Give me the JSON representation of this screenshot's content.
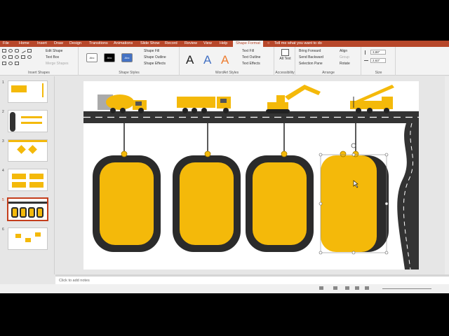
{
  "tabs": [
    "File",
    "Home",
    "Insert",
    "Draw",
    "Design",
    "Transitions",
    "Animations",
    "Slide Show",
    "Record",
    "Review",
    "View",
    "Help",
    "Shape Format"
  ],
  "active_tab": "Shape Format",
  "tell_me": "Tell me what you want to do",
  "ribbon": {
    "insert_shapes": {
      "edit_shape": "Edit Shape",
      "text_box": "Text Box",
      "merge_shapes": "Merge Shapes",
      "label": "Insert Shapes"
    },
    "shape_styles": {
      "swatch_text": "Abc",
      "fill": "Shape Fill",
      "outline": "Shape Outline",
      "effects": "Shape Effects",
      "label": "Shape Styles"
    },
    "wordart": {
      "letter": "A",
      "text_fill": "Text Fill",
      "text_outline": "Text Outline",
      "text_effects": "Text Effects",
      "label": "WordArt Styles"
    },
    "accessibility": {
      "alt_text": "Alt Text",
      "label": "Accessibility"
    },
    "arrange": {
      "bring_forward": "Bring Forward",
      "send_backward": "Send Backward",
      "selection_pane": "Selection Pane",
      "align": "Align",
      "group": "Group",
      "rotate": "Rotate",
      "label": "Arrange"
    },
    "size": {
      "height": "3,88\"",
      "width": "2,63\"",
      "label": "Size"
    }
  },
  "slides": [
    "1",
    "2",
    "3",
    "4",
    "5",
    "6"
  ],
  "active_slide": 5,
  "notes_placeholder": "Click to add notes",
  "colors": {
    "accent": "#b7472a",
    "yellow": "#f4b90a",
    "dark": "#2b2b2b",
    "road": "#333333"
  }
}
